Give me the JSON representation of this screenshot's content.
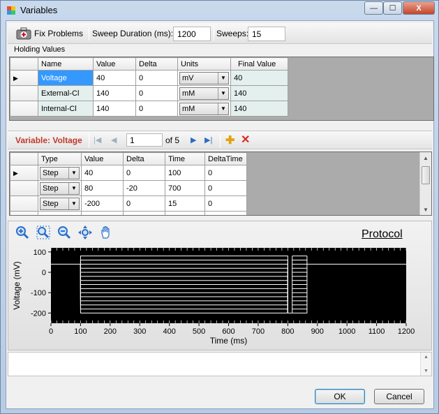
{
  "window": {
    "title": "Variables",
    "icon": "app-icon"
  },
  "titlebar_buttons": {
    "minimize": "—",
    "maximize": "☐",
    "close": "X"
  },
  "toolbar": {
    "fix_label": "Fix Problems",
    "sweep_duration_label": "Sweep Duration (ms):",
    "sweep_duration_value": "1200",
    "sweeps_label": "Sweeps:",
    "sweeps_value": "15"
  },
  "holding": {
    "label": "Holding Values",
    "columns": [
      "Name",
      "Value",
      "Delta",
      "Units",
      "Final Value"
    ],
    "rows": [
      {
        "name": "Voltage",
        "value": "40",
        "delta": "0",
        "units": "mV",
        "final": "40"
      },
      {
        "name": "External-Cl",
        "value": "140",
        "delta": "0",
        "units": "mM",
        "final": "140"
      },
      {
        "name": "Internal-Cl",
        "value": "140",
        "delta": "0",
        "units": "mM",
        "final": "140"
      }
    ]
  },
  "navigator": {
    "label": "Variable: Voltage",
    "position": "1",
    "count_text": "of 5"
  },
  "steps": {
    "columns": [
      "Type",
      "Value",
      "Delta",
      "Time",
      "DeltaTime"
    ],
    "rows": [
      {
        "type": "Step",
        "value": "40",
        "delta": "0",
        "time": "100",
        "delta_time": "0"
      },
      {
        "type": "Step",
        "value": "80",
        "delta": "-20",
        "time": "700",
        "delta_time": "0"
      },
      {
        "type": "Step",
        "value": "-200",
        "delta": "0",
        "time": "15",
        "delta_time": "0"
      }
    ]
  },
  "plot_tools": [
    "zoom-in-icon",
    "zoom-fit-icon",
    "zoom-out-icon",
    "pan-zoom-icon",
    "hand-icon"
  ],
  "chart_data": {
    "type": "line",
    "title": "Protocol",
    "xlabel": "Time (ms)",
    "ylabel": "Voltage (mV)",
    "xlim": [
      0,
      1200
    ],
    "ylim": [
      -250,
      120
    ],
    "xticks": [
      0,
      100,
      200,
      300,
      400,
      500,
      600,
      700,
      800,
      900,
      1000,
      1100,
      1200
    ],
    "yticks": [
      100,
      0,
      -100,
      -200
    ],
    "background": "#000000",
    "line_color": "#ffffff",
    "holding_mV": 40,
    "sweeps": [
      {
        "step1_start": 100,
        "step1_end": 800,
        "levels_mV": [
          80,
          60,
          40,
          20,
          0,
          -20,
          -40,
          -60,
          -80,
          -100,
          -120,
          -140,
          -160,
          -180,
          -200
        ]
      },
      {
        "step2_start": 815,
        "step2_end": 865,
        "level_mV": -200
      }
    ]
  },
  "buttons": {
    "ok": "OK",
    "cancel": "Cancel"
  }
}
